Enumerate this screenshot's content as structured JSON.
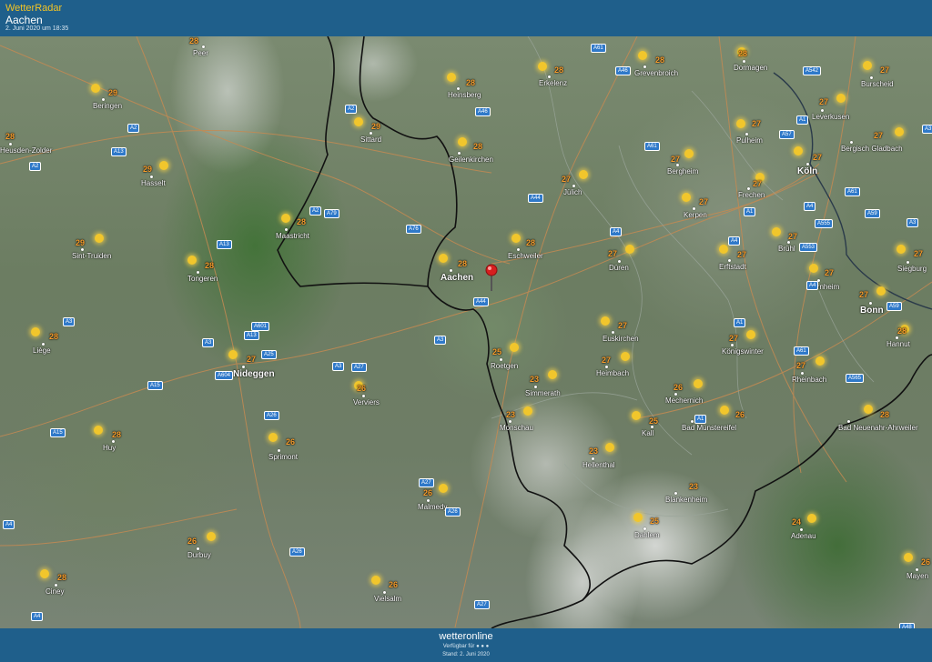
{
  "header": {
    "brand": "WetterRadar",
    "location": "Aachen",
    "datetime": "2. Juni 2020 um 18:35"
  },
  "footer": {
    "logo": "wetteronline",
    "availability": "Verfügbar für ● ● ●",
    "stand": "Stand: 2. Juni 2020"
  },
  "cities": [
    {
      "name": "Peer",
      "temp": "28"
    },
    {
      "name": "Beringen",
      "temp": "29"
    },
    {
      "name": "Heusden-Zolder",
      "temp": "28"
    },
    {
      "name": "Hasselt",
      "temp": "29"
    },
    {
      "name": "Sittard",
      "temp": "29"
    },
    {
      "name": "Heinsberg",
      "temp": "28"
    },
    {
      "name": "Erkelenz",
      "temp": "28"
    },
    {
      "name": "Grevenbroich",
      "temp": "28"
    },
    {
      "name": "Dormagen",
      "temp": "28"
    },
    {
      "name": "Burscheid",
      "temp": "27"
    },
    {
      "name": "Leverkusen",
      "temp": "27"
    },
    {
      "name": "Pulheim",
      "temp": "27"
    },
    {
      "name": "Bergisch Gladbach",
      "temp": "27"
    },
    {
      "name": "Geilenkirchen",
      "temp": "28"
    },
    {
      "name": "Jülich",
      "temp": "27"
    },
    {
      "name": "Bergheim",
      "temp": "27"
    },
    {
      "name": "Köln",
      "temp": "27"
    },
    {
      "name": "Frechen",
      "temp": "27"
    },
    {
      "name": "Kerpen",
      "temp": "27"
    },
    {
      "name": "Maastricht",
      "temp": "28"
    },
    {
      "name": "Sint-Truiden",
      "temp": "29"
    },
    {
      "name": "Tongeren",
      "temp": "28"
    },
    {
      "name": "Aachen",
      "temp": "28"
    },
    {
      "name": "Eschweiler",
      "temp": "28"
    },
    {
      "name": "Düren",
      "temp": "27"
    },
    {
      "name": "Erftstadt",
      "temp": "27"
    },
    {
      "name": "Brühl",
      "temp": "27"
    },
    {
      "name": "Siegburg",
      "temp": "27"
    },
    {
      "name": "Bornheim",
      "temp": "27"
    },
    {
      "name": "Bonn",
      "temp": "27"
    },
    {
      "name": "Hannut",
      "temp": "28"
    },
    {
      "name": "Liège",
      "temp": "28"
    },
    {
      "name": "Nideggen",
      "temp": "27"
    },
    {
      "name": "Euskirchen",
      "temp": "27"
    },
    {
      "name": "Königswinter",
      "temp": "27"
    },
    {
      "name": "Roetgen",
      "temp": "25"
    },
    {
      "name": "Heimbach",
      "temp": "27"
    },
    {
      "name": "Rheinbach",
      "temp": "27"
    },
    {
      "name": "Verviers",
      "temp": "26"
    },
    {
      "name": "Simmerath",
      "temp": "23"
    },
    {
      "name": "Mechernich",
      "temp": "26"
    },
    {
      "name": "Monschau",
      "temp": "23"
    },
    {
      "name": "Bad Münstereifel",
      "temp": "26"
    },
    {
      "name": "Bad Neuenahr-Ahrweiler",
      "temp": "28"
    },
    {
      "name": "Kall",
      "temp": "25"
    },
    {
      "name": "Huy",
      "temp": "28"
    },
    {
      "name": "Sprimont",
      "temp": "26"
    },
    {
      "name": "Hellenthal",
      "temp": "23"
    },
    {
      "name": "Blankenheim",
      "temp": "23"
    },
    {
      "name": "Malmedy",
      "temp": "26"
    },
    {
      "name": "Dahlem",
      "temp": "25"
    },
    {
      "name": "Adenau",
      "temp": "24"
    },
    {
      "name": "Durbuy",
      "temp": "26"
    },
    {
      "name": "Ciney",
      "temp": "28"
    },
    {
      "name": "Vielsalm",
      "temp": "26"
    },
    {
      "name": "Mayen",
      "temp": "26"
    }
  ],
  "highways": [
    "A61",
    "A46",
    "A542",
    "A2",
    "A2",
    "A46",
    "A1",
    "A57",
    "A3",
    "A2",
    "A61",
    "A13",
    "A2",
    "A79",
    "A76",
    "A44",
    "A4",
    "A4",
    "A1",
    "A4",
    "A555",
    "A59",
    "A13",
    "A61",
    "A553",
    "A3",
    "A4",
    "A44",
    "A59",
    "A3",
    "A601",
    "A13",
    "A3",
    "A25",
    "A3",
    "A27",
    "A3",
    "A1",
    "A61",
    "A604",
    "A15",
    "A565",
    "A26",
    "A15",
    "A1",
    "A27",
    "A26",
    "A4",
    "A4",
    "A26",
    "A27",
    "A48"
  ],
  "colors": {
    "header_bg": "#1f5f8b",
    "temp": "#f59c2c",
    "sun": "#f1c62c",
    "highway_shield": "#2f79c9"
  }
}
